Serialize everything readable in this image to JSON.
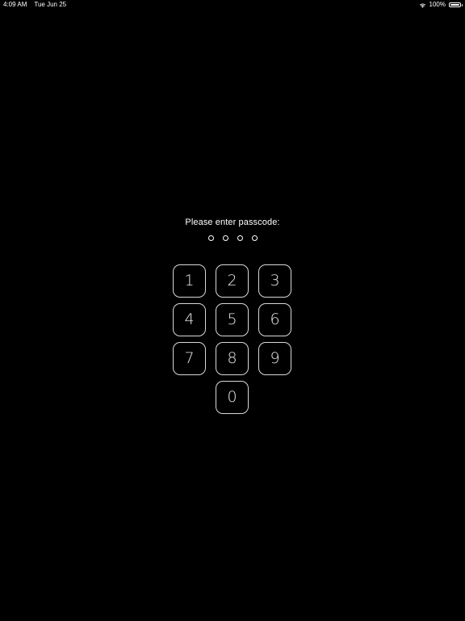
{
  "status_bar": {
    "time": "4:09 AM",
    "date": "Tue Jun 25",
    "battery_percent": "100%",
    "battery_level": 1.0,
    "icons": [
      "wifi-icon",
      "battery-icon"
    ]
  },
  "passcode": {
    "prompt": "Please enter passcode:",
    "digits_entered": 0,
    "digit_count": 4
  },
  "keypad": {
    "keys": [
      "1",
      "2",
      "3",
      "4",
      "5",
      "6",
      "7",
      "8",
      "9",
      "0"
    ]
  },
  "colors": {
    "background": "#000000",
    "foreground": "#ffffff",
    "key_border": "#d8d8d8"
  }
}
